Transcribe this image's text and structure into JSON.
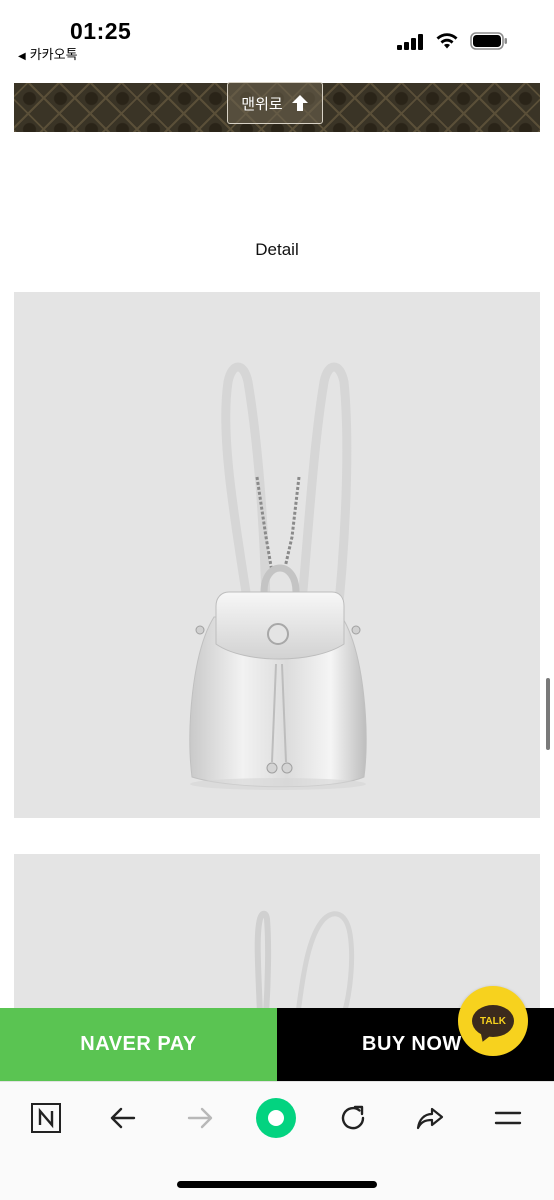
{
  "status_bar": {
    "time": "01:25",
    "back_app_label": "카카오톡"
  },
  "banner": {
    "top_button_label": "맨위로"
  },
  "detail": {
    "title": "Detail"
  },
  "purchase": {
    "naver_pay_label": "NAVER PAY",
    "buy_now_label": "BUY NOW",
    "talk_label": "TALK"
  },
  "colors": {
    "naver_green": "#5ac452",
    "kakao_yellow": "#f7d21e",
    "photo_background": "#e4e4e4"
  },
  "toolbar": {
    "icons": [
      "naver-n-icon",
      "back-arrow-icon",
      "forward-arrow-icon",
      "green-home-icon",
      "refresh-icon",
      "share-icon",
      "menu-icon"
    ]
  }
}
